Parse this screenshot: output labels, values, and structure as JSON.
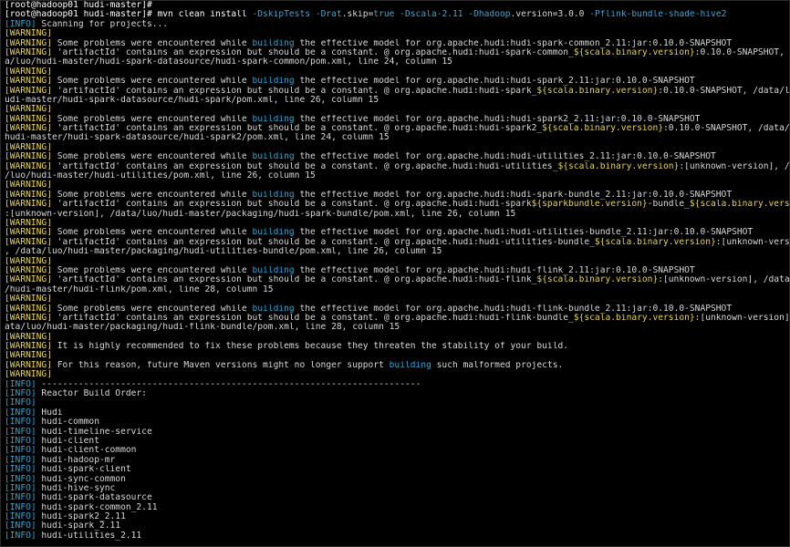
{
  "colors": {
    "background": "#000000",
    "text": "#d8d8d8",
    "warning": "#e8d44d",
    "info": "#2aa7d8",
    "flag": "#39a6d6"
  },
  "lines": [
    [
      {
        "t": "[root@hadoop01 hudi-master]# ",
        "c": "prompt"
      }
    ],
    [
      {
        "t": "[root@hadoop01 hudi-master]# mvn clean install ",
        "c": "prompt"
      },
      {
        "t": "-DskipTests",
        "c": "flag"
      },
      {
        "t": " ",
        "c": "white"
      },
      {
        "t": "-Drat",
        "c": "flag"
      },
      {
        "t": ".skip=",
        "c": "white"
      },
      {
        "t": "true",
        "c": "flag"
      },
      {
        "t": " ",
        "c": "white"
      },
      {
        "t": "-Dscala-2.11",
        "c": "flag"
      },
      {
        "t": " ",
        "c": "white"
      },
      {
        "t": "-Dhadoop",
        "c": "flag"
      },
      {
        "t": ".version=3.0.0 ",
        "c": "white"
      },
      {
        "t": "-Pflink-bundle-shade-hive2",
        "c": "flag"
      }
    ],
    [
      {
        "t": "[INFO]",
        "c": "cyan"
      },
      {
        "t": " Scanning for projects...",
        "c": "white"
      }
    ],
    [
      {
        "t": "[WARNING]",
        "c": "yellow"
      }
    ],
    [
      {
        "t": "[WARNING]",
        "c": "yellow"
      },
      {
        "t": " Some problems were encountered while ",
        "c": "white"
      },
      {
        "t": "building",
        "c": "cyan"
      },
      {
        "t": " the effective model for org.apache.hudi:hudi-spark-common_2.11:jar:0.10.0-SNAPSHOT",
        "c": "white"
      }
    ],
    [
      {
        "t": "[WARNING]",
        "c": "yellow"
      },
      {
        "t": " 'artifactId' contains an expression but should be a constant. @ org.apache.hudi:hudi-spark-common_",
        "c": "white"
      },
      {
        "t": "${scala.binary.version}",
        "c": "yellow"
      },
      {
        "t": ":0.10.0-SNAPSHOT, /dat",
        "c": "white"
      }
    ],
    [
      {
        "t": "a/luo/hudi-master/hudi-spark-datasource/hudi-spark-common/pom.xml, line 24, column 15",
        "c": "white"
      }
    ],
    [
      {
        "t": "[WARNING]",
        "c": "yellow"
      }
    ],
    [
      {
        "t": "[WARNING]",
        "c": "yellow"
      },
      {
        "t": " Some problems were encountered while ",
        "c": "white"
      },
      {
        "t": "building",
        "c": "cyan"
      },
      {
        "t": " the effective model for org.apache.hudi:hudi-spark_2.11:jar:0.10.0-SNAPSHOT",
        "c": "white"
      }
    ],
    [
      {
        "t": "[WARNING]",
        "c": "yellow"
      },
      {
        "t": " 'artifactId' contains an expression but should be a constant. @ org.apache.hudi:hudi-spark_",
        "c": "white"
      },
      {
        "t": "${scala.binary.version}",
        "c": "yellow"
      },
      {
        "t": ":0.10.0-SNAPSHOT, /data/luo/h",
        "c": "white"
      }
    ],
    [
      {
        "t": "udi-master/hudi-spark-datasource/hudi-spark/pom.xml, line 26, column 15",
        "c": "white"
      }
    ],
    [
      {
        "t": "[WARNING]",
        "c": "yellow"
      }
    ],
    [
      {
        "t": "[WARNING]",
        "c": "yellow"
      },
      {
        "t": " Some problems were encountered while ",
        "c": "white"
      },
      {
        "t": "building",
        "c": "cyan"
      },
      {
        "t": " the effective model for org.apache.hudi:hudi-spark2_2.11:jar:0.10.0-SNAPSHOT",
        "c": "white"
      }
    ],
    [
      {
        "t": "[WARNING]",
        "c": "yellow"
      },
      {
        "t": " 'artifactId' contains an expression but should be a constant. @ org.apache.hudi:hudi-spark2_",
        "c": "white"
      },
      {
        "t": "${scala.binary.version}",
        "c": "yellow"
      },
      {
        "t": ":0.10.0-SNAPSHOT, /data/luo/",
        "c": "white"
      }
    ],
    [
      {
        "t": "hudi-master/hudi-spark-datasource/hudi-spark2/pom.xml, line 24, column 15",
        "c": "white"
      }
    ],
    [
      {
        "t": "[WARNING]",
        "c": "yellow"
      }
    ],
    [
      {
        "t": "[WARNING]",
        "c": "yellow"
      },
      {
        "t": " Some problems were encountered while ",
        "c": "white"
      },
      {
        "t": "building",
        "c": "cyan"
      },
      {
        "t": " the effective model for org.apache.hudi:hudi-utilities_2.11:jar:0.10.0-SNAPSHOT",
        "c": "white"
      }
    ],
    [
      {
        "t": "[WARNING]",
        "c": "yellow"
      },
      {
        "t": " 'artifactId' contains an expression but should be a constant. @ org.apache.hudi:hudi-utilities_",
        "c": "white"
      },
      {
        "t": "${scala.binary.version}",
        "c": "yellow"
      },
      {
        "t": ":[unknown-version], /data",
        "c": "white"
      }
    ],
    [
      {
        "t": "/luo/hudi-master/hudi-utilities/pom.xml, line 26, column 15",
        "c": "white"
      }
    ],
    [
      {
        "t": "[WARNING]",
        "c": "yellow"
      }
    ],
    [
      {
        "t": "[WARNING]",
        "c": "yellow"
      },
      {
        "t": " Some problems were encountered while ",
        "c": "white"
      },
      {
        "t": "building",
        "c": "cyan"
      },
      {
        "t": " the effective model for org.apache.hudi:hudi-spark-bundle_2.11:jar:0.10.0-SNAPSHOT",
        "c": "white"
      }
    ],
    [
      {
        "t": "[WARNING]",
        "c": "yellow"
      },
      {
        "t": " 'artifactId' contains an expression but should be a constant. @ org.apache.hudi:hudi-spark",
        "c": "white"
      },
      {
        "t": "${sparkbundle.version}",
        "c": "yellow"
      },
      {
        "t": "-bundle_",
        "c": "white"
      },
      {
        "t": "${scala.binary.version}",
        "c": "yellow"
      }
    ],
    [
      {
        "t": ":[unknown-version], /data/luo/hudi-master/packaging/hudi-spark-bundle/pom.xml, line 26, column 15",
        "c": "white"
      }
    ],
    [
      {
        "t": "[WARNING]",
        "c": "yellow"
      }
    ],
    [
      {
        "t": "[WARNING]",
        "c": "yellow"
      },
      {
        "t": " Some problems were encountered while ",
        "c": "white"
      },
      {
        "t": "building",
        "c": "cyan"
      },
      {
        "t": " the effective model for org.apache.hudi:hudi-utilities-bundle_2.11:jar:0.10.0-SNAPSHOT",
        "c": "white"
      }
    ],
    [
      {
        "t": "[WARNING]",
        "c": "yellow"
      },
      {
        "t": " 'artifactId' contains an expression but should be a constant. @ org.apache.hudi:hudi-utilities-bundle_",
        "c": "white"
      },
      {
        "t": "${scala.binary.version}",
        "c": "yellow"
      },
      {
        "t": ":[unknown-version]",
        "c": "white"
      }
    ],
    [
      {
        "t": ", /data/luo/hudi-master/packaging/hudi-utilities-bundle/pom.xml, line 26, column 15",
        "c": "white"
      }
    ],
    [
      {
        "t": "[WARNING]",
        "c": "yellow"
      }
    ],
    [
      {
        "t": "[WARNING]",
        "c": "yellow"
      },
      {
        "t": " Some problems were encountered while ",
        "c": "white"
      },
      {
        "t": "building",
        "c": "cyan"
      },
      {
        "t": " the effective model for org.apache.hudi:hudi-flink_2.11:jar:0.10.0-SNAPSHOT",
        "c": "white"
      }
    ],
    [
      {
        "t": "[WARNING]",
        "c": "yellow"
      },
      {
        "t": " 'artifactId' contains an expression but should be a constant. @ org.apache.hudi:hudi-flink_",
        "c": "white"
      },
      {
        "t": "${scala.binary.version}",
        "c": "yellow"
      },
      {
        "t": ":[unknown-version], /data/luo",
        "c": "white"
      }
    ],
    [
      {
        "t": "/hudi-master/hudi-flink/pom.xml, line 28, column 15",
        "c": "white"
      }
    ],
    [
      {
        "t": "[WARNING]",
        "c": "yellow"
      }
    ],
    [
      {
        "t": "[WARNING]",
        "c": "yellow"
      },
      {
        "t": " Some problems were encountered while ",
        "c": "white"
      },
      {
        "t": "building",
        "c": "cyan"
      },
      {
        "t": " the effective model for org.apache.hudi:hudi-flink-bundle_2.11:jar:0.10.0-SNAPSHOT",
        "c": "white"
      }
    ],
    [
      {
        "t": "[WARNING]",
        "c": "yellow"
      },
      {
        "t": " 'artifactId' contains an expression but should be a constant. @ org.apache.hudi:hudi-flink-bundle_",
        "c": "white"
      },
      {
        "t": "${scala.binary.version}",
        "c": "yellow"
      },
      {
        "t": ":[unknown-version], /d",
        "c": "white"
      }
    ],
    [
      {
        "t": "ata/luo/hudi-master/packaging/hudi-flink-bundle/pom.xml, line 28, column 15",
        "c": "white"
      }
    ],
    [
      {
        "t": "[WARNING]",
        "c": "yellow"
      }
    ],
    [
      {
        "t": "[WARNING]",
        "c": "yellow"
      },
      {
        "t": " It is highly recommended to fix these problems because they threaten the stability of your build.",
        "c": "white"
      }
    ],
    [
      {
        "t": "[WARNING]",
        "c": "yellow"
      }
    ],
    [
      {
        "t": "[WARNING]",
        "c": "yellow"
      },
      {
        "t": " For this reason, future Maven versions might no longer support ",
        "c": "white"
      },
      {
        "t": "building",
        "c": "cyan"
      },
      {
        "t": " such malformed projects.",
        "c": "white"
      }
    ],
    [
      {
        "t": "[WARNING]",
        "c": "yellow"
      }
    ],
    [
      {
        "t": "[INFO]",
        "c": "cyan"
      },
      {
        "t": " ------------------------------------------------------------------------",
        "c": "white"
      }
    ],
    [
      {
        "t": "[INFO]",
        "c": "cyan"
      },
      {
        "t": " Reactor Build Order:",
        "c": "white"
      }
    ],
    [
      {
        "t": "[INFO]",
        "c": "cyan"
      }
    ],
    [
      {
        "t": "[INFO]",
        "c": "cyan"
      },
      {
        "t": " Hudi",
        "c": "white"
      }
    ],
    [
      {
        "t": "[INFO]",
        "c": "cyan"
      },
      {
        "t": " hudi-common",
        "c": "white"
      }
    ],
    [
      {
        "t": "[INFO]",
        "c": "cyan"
      },
      {
        "t": " hudi-timeline-service",
        "c": "white"
      }
    ],
    [
      {
        "t": "[INFO]",
        "c": "cyan"
      },
      {
        "t": " hudi-client",
        "c": "white"
      }
    ],
    [
      {
        "t": "[INFO]",
        "c": "cyan"
      },
      {
        "t": " hudi-client-common",
        "c": "white"
      }
    ],
    [
      {
        "t": "[INFO]",
        "c": "cyan"
      },
      {
        "t": " hudi-hadoop-mr",
        "c": "white"
      }
    ],
    [
      {
        "t": "[INFO]",
        "c": "cyan"
      },
      {
        "t": " hudi-spark-client",
        "c": "white"
      }
    ],
    [
      {
        "t": "[INFO]",
        "c": "cyan"
      },
      {
        "t": " hudi-sync-common",
        "c": "white"
      }
    ],
    [
      {
        "t": "[INFO]",
        "c": "cyan"
      },
      {
        "t": " hudi-hive-sync",
        "c": "white"
      }
    ],
    [
      {
        "t": "[INFO]",
        "c": "cyan"
      },
      {
        "t": " hudi-spark-datasource",
        "c": "white"
      }
    ],
    [
      {
        "t": "[INFO]",
        "c": "cyan"
      },
      {
        "t": " hudi-spark-common_2.11",
        "c": "white"
      }
    ],
    [
      {
        "t": "[INFO]",
        "c": "cyan"
      },
      {
        "t": " hudi-spark2_2.11",
        "c": "white"
      }
    ],
    [
      {
        "t": "[INFO]",
        "c": "cyan"
      },
      {
        "t": " hudi-spark_2.11",
        "c": "white"
      }
    ],
    [
      {
        "t": "[INFO]",
        "c": "cyan"
      },
      {
        "t": " hudi-utilities_2.11",
        "c": "white"
      }
    ]
  ]
}
